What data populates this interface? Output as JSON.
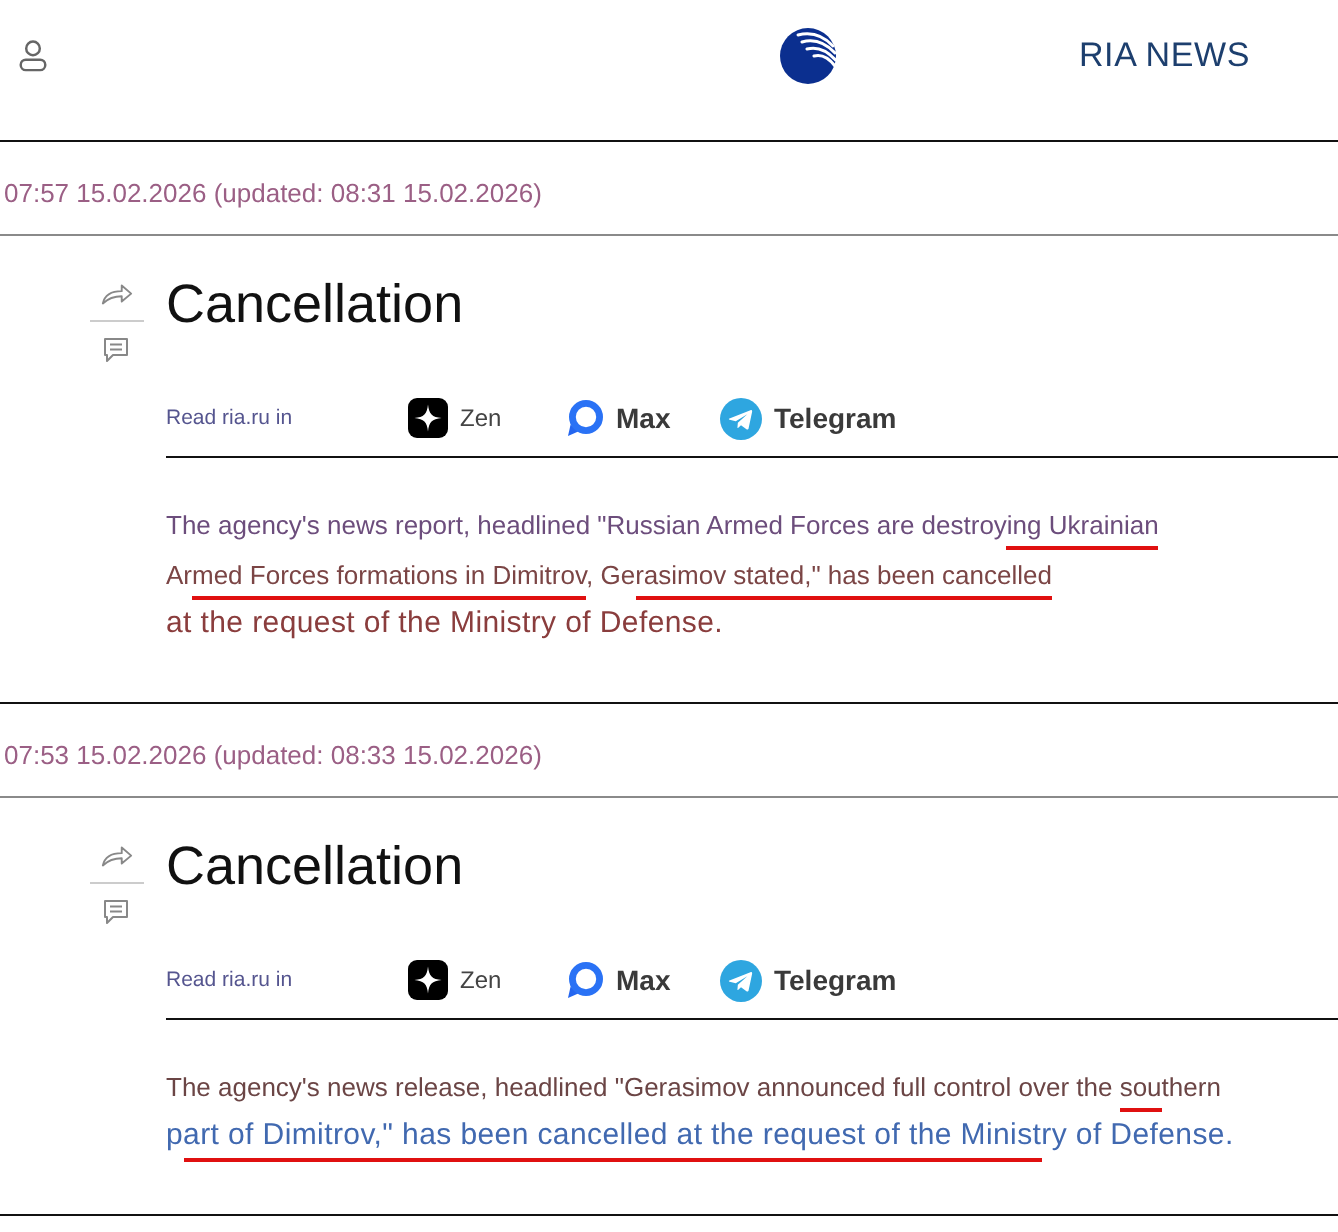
{
  "header": {
    "brand": "RIA NEWS"
  },
  "articles": [
    {
      "timestamp": "07:57 15.02.2026 (updated: 08:31 15.02.2026)",
      "title": "Cancellation",
      "read_in": {
        "label": "Read ria.ru in",
        "channels": [
          {
            "kind": "zen",
            "name": "Zen"
          },
          {
            "kind": "max",
            "name": "Max"
          },
          {
            "kind": "telegram",
            "name": "Telegram"
          }
        ]
      },
      "lines": [
        {
          "kind": "small",
          "color": "#6c4d7c",
          "parts": [
            {
              "text": "The agency's news report, headlined \"Russian Armed Forces are destroy",
              "underlined": false
            },
            {
              "text": "ing Ukrainian",
              "underlined": true
            }
          ]
        },
        {
          "kind": "small",
          "color": "#7b4545",
          "parts": [
            {
              "text": "Ar",
              "underlined": false
            },
            {
              "text": "med Forces formations in Dimitrov",
              "underlined": true
            },
            {
              "text": ", Ge",
              "underlined": false
            },
            {
              "text": "rasimov stated,\" has been cancelled",
              "underlined": true
            }
          ]
        },
        {
          "kind": "large",
          "color": "#8a3d3d",
          "parts": [
            {
              "text": "at the request of the Ministry of Defense.",
              "underlined": false
            }
          ]
        }
      ]
    },
    {
      "timestamp": "07:53 15.02.2026 (updated: 08:33 15.02.2026)",
      "title": "Cancellation",
      "read_in": {
        "label": "Read ria.ru in",
        "channels": [
          {
            "kind": "zen",
            "name": "Zen"
          },
          {
            "kind": "max",
            "name": "Max"
          },
          {
            "kind": "telegram",
            "name": "Telegram"
          }
        ]
      },
      "lines": [
        {
          "kind": "small",
          "color": "#6b4545",
          "parts": [
            {
              "text": "The agency's news release, headlined \"Gerasimov announced full control over the ",
              "underlined": false
            },
            {
              "text": "sou",
              "underlined": true
            },
            {
              "text": "thern",
              "underlined": false
            }
          ]
        },
        {
          "kind": "large",
          "color": "#4169b0",
          "parts": [
            {
              "text": "p",
              "underlined": false
            },
            {
              "text": "art of Dimitrov,\" has been cancelled at the request of the Minist",
              "underlined": true
            },
            {
              "text": "ry of Defense.",
              "underlined": false
            }
          ]
        }
      ]
    }
  ]
}
